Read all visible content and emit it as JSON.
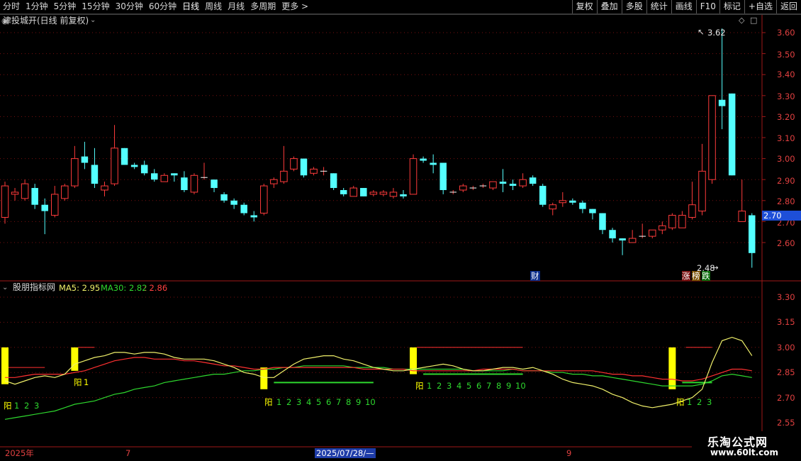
{
  "toolbar": {
    "tabs": [
      "分时",
      "1分钟",
      "5分钟",
      "15分钟",
      "30分钟",
      "60分钟",
      "日线",
      "周线",
      "月线",
      "多周期",
      "更多 >"
    ],
    "active_tab": "日线",
    "tools": [
      "复权",
      "叠加",
      "多股",
      "统计",
      "画线",
      "F10",
      "标记",
      "+自选",
      "返回"
    ]
  },
  "main_panel": {
    "title": "津投城开(日线 前复权)",
    "price_axis": [
      "3.60",
      "3.50",
      "3.40",
      "3.30",
      "3.20",
      "3.10",
      "3.00",
      "2.90",
      "2.80",
      "2.70",
      "2.60"
    ],
    "current_price": "2.70",
    "high_label": "3.62",
    "low_label": "2.48",
    "event_tags": [
      "财",
      "涨",
      "榜",
      "跌"
    ]
  },
  "indicator_panel": {
    "title": "股朋指标网",
    "ma5_label": "MA5: 2.95",
    "ma30_label": "MA30: 2.82",
    "extra_label": ": 2.86",
    "axis": [
      "3.30",
      "3.15",
      "3.00",
      "2.85",
      "2.70",
      "2.55"
    ],
    "signal_labels": [
      "阳",
      "1",
      "2",
      "3",
      "阳",
      "1",
      "2",
      "3",
      "4",
      "5",
      "6",
      "7",
      "8",
      "9",
      "10",
      "阳",
      "1",
      "2",
      "3",
      "4",
      "5",
      "6",
      "7",
      "8",
      "9",
      "10",
      "阳",
      "1",
      "2",
      "3"
    ]
  },
  "time_axis": {
    "labels": [
      "2025年",
      "7",
      "9"
    ],
    "cursor_date": "2025/07/28/—"
  },
  "watermark": {
    "line1": "乐淘公式网",
    "line2": "www.60lt.com"
  },
  "colors": {
    "up": "#ff3b3b",
    "down": "#54ffff",
    "ma5": "#f0f06a",
    "ma30": "#2ed82e",
    "signal": "#ffff00",
    "grid": "#7a1010"
  },
  "chart_data": {
    "type": "candlestick",
    "candles": [
      {
        "o": 2.72,
        "h": 2.89,
        "l": 2.69,
        "c": 2.87
      },
      {
        "o": 2.83,
        "h": 2.86,
        "l": 2.8,
        "c": 2.84
      },
      {
        "o": 2.81,
        "h": 2.9,
        "l": 2.8,
        "c": 2.88
      },
      {
        "o": 2.86,
        "h": 2.88,
        "l": 2.76,
        "c": 2.78
      },
      {
        "o": 2.78,
        "h": 2.81,
        "l": 2.64,
        "c": 2.75
      },
      {
        "o": 2.73,
        "h": 2.87,
        "l": 2.72,
        "c": 2.83
      },
      {
        "o": 2.81,
        "h": 2.88,
        "l": 2.8,
        "c": 2.87
      },
      {
        "o": 2.87,
        "h": 3.06,
        "l": 2.86,
        "c": 3.0
      },
      {
        "o": 3.01,
        "h": 3.08,
        "l": 2.95,
        "c": 2.98
      },
      {
        "o": 2.97,
        "h": 3.05,
        "l": 2.86,
        "c": 2.88
      },
      {
        "o": 2.85,
        "h": 2.89,
        "l": 2.82,
        "c": 2.87
      },
      {
        "o": 2.88,
        "h": 3.16,
        "l": 2.87,
        "c": 3.05
      },
      {
        "o": 3.05,
        "h": 3.05,
        "l": 2.97,
        "c": 2.97
      },
      {
        "o": 2.97,
        "h": 2.98,
        "l": 2.95,
        "c": 2.96
      },
      {
        "o": 2.97,
        "h": 2.99,
        "l": 2.92,
        "c": 2.93
      },
      {
        "o": 2.93,
        "h": 2.95,
        "l": 2.89,
        "c": 2.9
      },
      {
        "o": 2.89,
        "h": 2.93,
        "l": 2.89,
        "c": 2.92
      },
      {
        "o": 2.93,
        "h": 2.93,
        "l": 2.89,
        "c": 2.92
      },
      {
        "o": 2.91,
        "h": 2.94,
        "l": 2.84,
        "c": 2.85
      },
      {
        "o": 2.84,
        "h": 2.93,
        "l": 2.83,
        "c": 2.92
      },
      {
        "o": 2.91,
        "h": 2.98,
        "l": 2.9,
        "c": 2.91
      },
      {
        "o": 2.9,
        "h": 2.9,
        "l": 2.84,
        "c": 2.86
      },
      {
        "o": 2.83,
        "h": 2.84,
        "l": 2.79,
        "c": 2.8
      },
      {
        "o": 2.8,
        "h": 2.81,
        "l": 2.76,
        "c": 2.78
      },
      {
        "o": 2.78,
        "h": 2.79,
        "l": 2.73,
        "c": 2.74
      },
      {
        "o": 2.73,
        "h": 2.75,
        "l": 2.7,
        "c": 2.72
      },
      {
        "o": 2.74,
        "h": 2.88,
        "l": 2.73,
        "c": 2.87
      },
      {
        "o": 2.88,
        "h": 2.91,
        "l": 2.86,
        "c": 2.9
      },
      {
        "o": 2.89,
        "h": 3.06,
        "l": 2.88,
        "c": 2.94
      },
      {
        "o": 2.95,
        "h": 3.01,
        "l": 2.94,
        "c": 3.0
      },
      {
        "o": 3.0,
        "h": 3.0,
        "l": 2.91,
        "c": 2.92
      },
      {
        "o": 2.93,
        "h": 2.96,
        "l": 2.92,
        "c": 2.95
      },
      {
        "o": 2.94,
        "h": 2.96,
        "l": 2.92,
        "c": 2.94
      },
      {
        "o": 2.93,
        "h": 2.93,
        "l": 2.85,
        "c": 2.86
      },
      {
        "o": 2.85,
        "h": 2.86,
        "l": 2.82,
        "c": 2.83
      },
      {
        "o": 2.82,
        "h": 2.87,
        "l": 2.82,
        "c": 2.86
      },
      {
        "o": 2.86,
        "h": 2.86,
        "l": 2.82,
        "c": 2.82
      },
      {
        "o": 2.83,
        "h": 2.85,
        "l": 2.82,
        "c": 2.84
      },
      {
        "o": 2.83,
        "h": 2.85,
        "l": 2.82,
        "c": 2.84
      },
      {
        "o": 2.82,
        "h": 2.86,
        "l": 2.81,
        "c": 2.84
      },
      {
        "o": 2.83,
        "h": 2.85,
        "l": 2.81,
        "c": 2.82
      },
      {
        "o": 2.83,
        "h": 3.02,
        "l": 2.83,
        "c": 3.0
      },
      {
        "o": 3.0,
        "h": 3.01,
        "l": 2.98,
        "c": 2.99
      },
      {
        "o": 2.98,
        "h": 3.02,
        "l": 2.93,
        "c": 2.97
      },
      {
        "o": 2.98,
        "h": 2.98,
        "l": 2.83,
        "c": 2.85
      },
      {
        "o": 2.84,
        "h": 2.85,
        "l": 2.83,
        "c": 2.84
      },
      {
        "o": 2.85,
        "h": 2.88,
        "l": 2.84,
        "c": 2.87
      },
      {
        "o": 2.86,
        "h": 2.87,
        "l": 2.85,
        "c": 2.86
      },
      {
        "o": 2.87,
        "h": 2.88,
        "l": 2.86,
        "c": 2.87
      },
      {
        "o": 2.86,
        "h": 2.89,
        "l": 2.85,
        "c": 2.89
      },
      {
        "o": 2.89,
        "h": 2.95,
        "l": 2.84,
        "c": 2.88
      },
      {
        "o": 2.88,
        "h": 2.9,
        "l": 2.85,
        "c": 2.87
      },
      {
        "o": 2.87,
        "h": 2.93,
        "l": 2.86,
        "c": 2.9
      },
      {
        "o": 2.91,
        "h": 2.92,
        "l": 2.87,
        "c": 2.88
      },
      {
        "o": 2.87,
        "h": 2.88,
        "l": 2.77,
        "c": 2.78
      },
      {
        "o": 2.76,
        "h": 2.79,
        "l": 2.73,
        "c": 2.78
      },
      {
        "o": 2.79,
        "h": 2.84,
        "l": 2.77,
        "c": 2.8
      },
      {
        "o": 2.8,
        "h": 2.81,
        "l": 2.78,
        "c": 2.79
      },
      {
        "o": 2.79,
        "h": 2.8,
        "l": 2.74,
        "c": 2.76
      },
      {
        "o": 2.76,
        "h": 2.76,
        "l": 2.71,
        "c": 2.74
      },
      {
        "o": 2.74,
        "h": 2.74,
        "l": 2.64,
        "c": 2.66
      },
      {
        "o": 2.66,
        "h": 2.67,
        "l": 2.6,
        "c": 2.62
      },
      {
        "o": 2.62,
        "h": 2.62,
        "l": 2.54,
        "c": 2.61
      },
      {
        "o": 2.6,
        "h": 2.66,
        "l": 2.6,
        "c": 2.62
      },
      {
        "o": 2.63,
        "h": 2.69,
        "l": 2.62,
        "c": 2.63
      },
      {
        "o": 2.63,
        "h": 2.66,
        "l": 2.62,
        "c": 2.66
      },
      {
        "o": 2.66,
        "h": 2.7,
        "l": 2.64,
        "c": 2.68
      },
      {
        "o": 2.67,
        "h": 2.74,
        "l": 2.66,
        "c": 2.73
      },
      {
        "o": 2.67,
        "h": 2.75,
        "l": 2.67,
        "c": 2.73
      },
      {
        "o": 2.72,
        "h": 2.89,
        "l": 2.71,
        "c": 2.78
      },
      {
        "o": 2.75,
        "h": 3.07,
        "l": 2.73,
        "c": 2.94
      },
      {
        "o": 2.9,
        "h": 3.3,
        "l": 2.88,
        "c": 3.3
      },
      {
        "o": 3.28,
        "h": 3.62,
        "l": 3.14,
        "c": 3.25
      },
      {
        "o": 3.31,
        "h": 3.31,
        "l": 2.92,
        "c": 2.92
      },
      {
        "o": 2.7,
        "h": 2.9,
        "l": 2.7,
        "c": 2.75
      },
      {
        "o": 2.73,
        "h": 2.74,
        "l": 2.48,
        "c": 2.55
      }
    ],
    "indicator": {
      "ma5": [
        2.8,
        2.78,
        2.8,
        2.82,
        2.83,
        2.82,
        2.84,
        2.9,
        2.92,
        2.94,
        2.95,
        2.97,
        2.97,
        2.96,
        2.97,
        2.97,
        2.96,
        2.94,
        2.93,
        2.93,
        2.93,
        2.92,
        2.9,
        2.88,
        2.85,
        2.84,
        2.82,
        2.82,
        2.86,
        2.9,
        2.93,
        2.94,
        2.95,
        2.95,
        2.93,
        2.92,
        2.9,
        2.88,
        2.87,
        2.86,
        2.86,
        2.87,
        2.88,
        2.89,
        2.9,
        2.89,
        2.87,
        2.86,
        2.86,
        2.87,
        2.88,
        2.88,
        2.87,
        2.88,
        2.86,
        2.84,
        2.81,
        2.79,
        2.78,
        2.77,
        2.75,
        2.72,
        2.7,
        2.67,
        2.65,
        2.64,
        2.65,
        2.66,
        2.68,
        2.7,
        2.75,
        2.91,
        3.04,
        3.06,
        3.04,
        2.95
      ],
      "ma30": [
        2.57,
        2.58,
        2.59,
        2.6,
        2.61,
        2.62,
        2.64,
        2.66,
        2.67,
        2.68,
        2.7,
        2.72,
        2.73,
        2.75,
        2.76,
        2.77,
        2.79,
        2.8,
        2.81,
        2.82,
        2.83,
        2.84,
        2.84,
        2.85,
        2.86,
        2.86,
        2.87,
        2.87,
        2.88,
        2.88,
        2.89,
        2.89,
        2.89,
        2.89,
        2.89,
        2.88,
        2.88,
        2.88,
        2.88,
        2.87,
        2.87,
        2.87,
        2.87,
        2.87,
        2.87,
        2.87,
        2.87,
        2.86,
        2.86,
        2.86,
        2.86,
        2.87,
        2.86,
        2.86,
        2.86,
        2.85,
        2.85,
        2.84,
        2.84,
        2.83,
        2.83,
        2.82,
        2.81,
        2.8,
        2.79,
        2.78,
        2.77,
        2.77,
        2.77,
        2.77,
        2.78,
        2.8,
        2.83,
        2.84,
        2.83,
        2.82
      ],
      "extra": [
        2.82,
        2.82,
        2.83,
        2.84,
        2.84,
        2.84,
        2.84,
        2.85,
        2.86,
        2.88,
        2.9,
        2.92,
        2.93,
        2.94,
        2.94,
        2.93,
        2.93,
        2.93,
        2.92,
        2.92,
        2.91,
        2.9,
        2.89,
        2.89,
        2.88,
        2.87,
        2.87,
        2.88,
        2.88,
        2.88,
        2.88,
        2.88,
        2.88,
        2.88,
        2.88,
        2.88,
        2.87,
        2.87,
        2.87,
        2.87,
        2.87,
        2.86,
        2.86,
        2.86,
        2.86,
        2.86,
        2.86,
        2.86,
        2.87,
        2.87,
        2.87,
        2.87,
        2.86,
        2.86,
        2.86,
        2.86,
        2.86,
        2.86,
        2.86,
        2.86,
        2.85,
        2.84,
        2.84,
        2.83,
        2.83,
        2.82,
        2.81,
        2.81,
        2.8,
        2.8,
        2.81,
        2.83,
        2.85,
        2.87,
        2.87,
        2.86
      ],
      "ylim": [
        2.55,
        3.38
      ]
    },
    "ylim": [
      2.48,
      3.67
    ]
  }
}
